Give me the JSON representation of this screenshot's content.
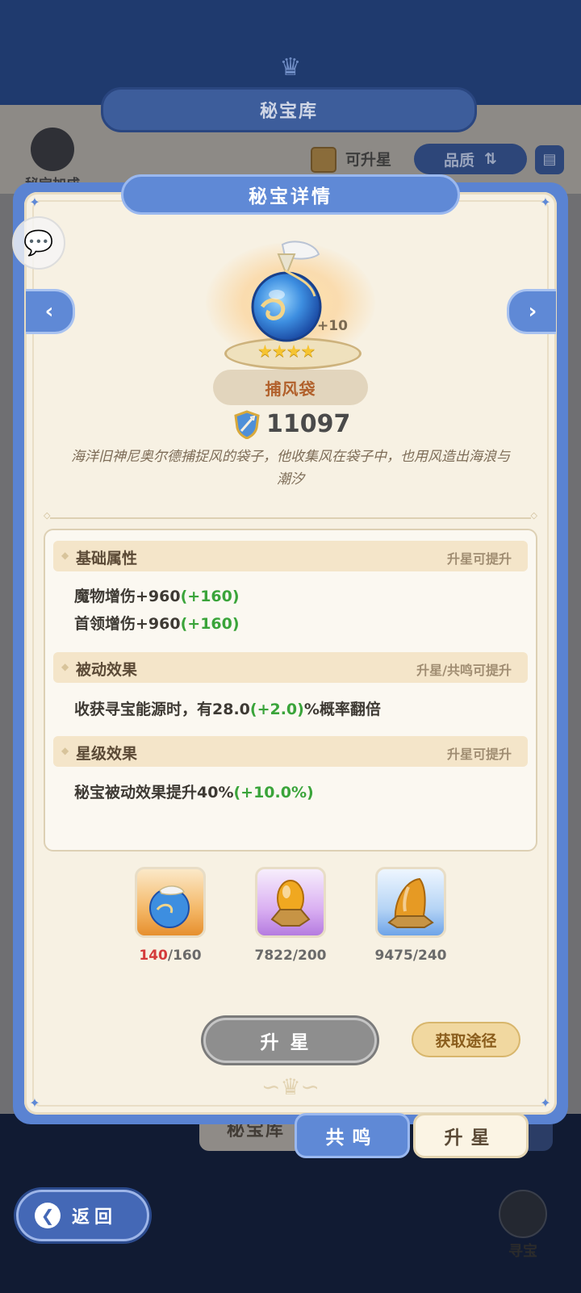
{
  "background": {
    "screen_title": "秘宝库",
    "bonus_label": "秘宝加成",
    "upgradable_label": "可升星",
    "quality_label": "品质",
    "tab_library": "秘宝库",
    "treasure_hunt_label": "寻宝"
  },
  "modal": {
    "title": "秘宝详情",
    "item": {
      "level_badge": "+10",
      "stars": 4,
      "stars_text": "★★★★",
      "name": "捕风袋",
      "power": "11097",
      "description": "海洋旧神尼奥尔德捕捉风的袋子，他收集风在袋子中，也用风造出海浪与潮汐"
    },
    "sections": [
      {
        "title": "基础属性",
        "hint": "升星可提升",
        "lines": [
          {
            "text": "魔物增伤+960",
            "bonus": "(+160)"
          },
          {
            "text": "首领增伤+960",
            "bonus": "(+160)"
          }
        ]
      },
      {
        "title": "被动效果",
        "hint": "升星/共鸣可提升",
        "lines": [
          {
            "text": "收获寻宝能源时，有28.0",
            "bonus": "(+2.0)",
            "suffix": "%概率翻倍"
          }
        ]
      },
      {
        "title": "星级效果",
        "hint": "升星可提升",
        "lines": [
          {
            "text": "秘宝被动效果提升40%",
            "bonus": "(+10.0%)"
          }
        ]
      }
    ],
    "materials": [
      {
        "icon": "wind-bag-icon",
        "have": "140",
        "need": "/160",
        "insufficient": true
      },
      {
        "icon": "amber-stone-purple-icon",
        "have": "7822",
        "need": "/200",
        "insufficient": false
      },
      {
        "icon": "amber-stone-blue-icon",
        "have": "9475",
        "need": "/240",
        "insufficient": false
      }
    ],
    "upstar_button": "升星",
    "obtain_button": "获取途径",
    "tabs": {
      "resonance": "共鸣",
      "upstar": "升星"
    }
  },
  "back_button": "返回",
  "colors": {
    "modal_blue": "#5f89d6",
    "cream": "#f7f1e3",
    "bonus_green": "#3aa43a",
    "insufficient_red": "#d43b3b",
    "item_name": "#b1602b"
  }
}
